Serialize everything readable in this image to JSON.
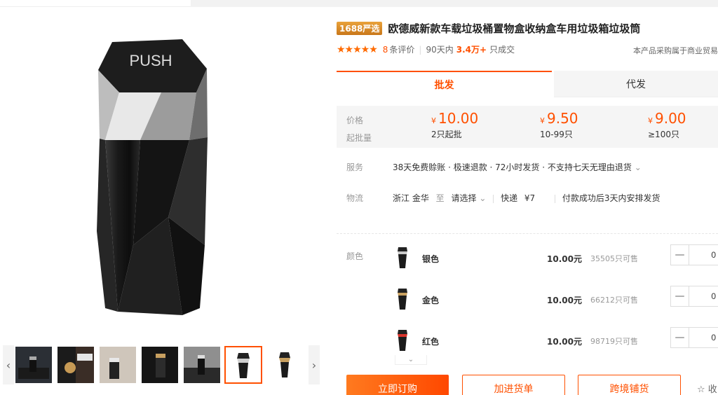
{
  "product": {
    "badge": "1688严选",
    "title": "欧德威新款车载垃圾桶置物盒收纳盒车用垃圾箱垃圾筒",
    "stars": "★★★★★",
    "review_count": "8",
    "review_suffix": "条评价",
    "sold_prefix": "90天内",
    "sold_value": "3.4万+",
    "sold_suffix": "只成交",
    "notice": "本产品采购属于商业贸易",
    "image_text": "PUSH"
  },
  "tabs": [
    {
      "label": "批发",
      "active": true
    },
    {
      "label": "代发",
      "active": false
    }
  ],
  "price_box": {
    "price_label": "价格",
    "moq_label": "起批量",
    "currency": "¥",
    "tiers": [
      {
        "price": "10.00",
        "qty": "2只起批"
      },
      {
        "price": "9.50",
        "qty": "10-99只"
      },
      {
        "price": "9.00",
        "qty": "≥100只"
      }
    ]
  },
  "service": {
    "label": "服务",
    "text": "38天免费赊账 · 极速退款 · 72小时发货 · 不支持七天无理由退货"
  },
  "logistics": {
    "label": "物流",
    "from": "浙江 金华",
    "to_word": "至",
    "select": "请选择",
    "express_label": "快递",
    "express_price": "¥7",
    "ship_note": "付款成功后3天内安排发货"
  },
  "sku": {
    "label": "颜色",
    "items": [
      {
        "name": "银色",
        "price": "10.00元",
        "stock": "35505只可售",
        "qty": "0",
        "cap_color": "#c9c9c9"
      },
      {
        "name": "金色",
        "price": "10.00元",
        "stock": "66212只可售",
        "qty": "0",
        "cap_color": "#c8a060"
      },
      {
        "name": "红色",
        "price": "10.00元",
        "stock": "98719只可售",
        "qty": "0",
        "cap_color": "#d8342c"
      }
    ]
  },
  "actions": {
    "order": "立即订购",
    "cart": "加进货单",
    "cross": "跨境铺货",
    "fav": "收"
  },
  "colors": {
    "accent": "#ff5000"
  }
}
